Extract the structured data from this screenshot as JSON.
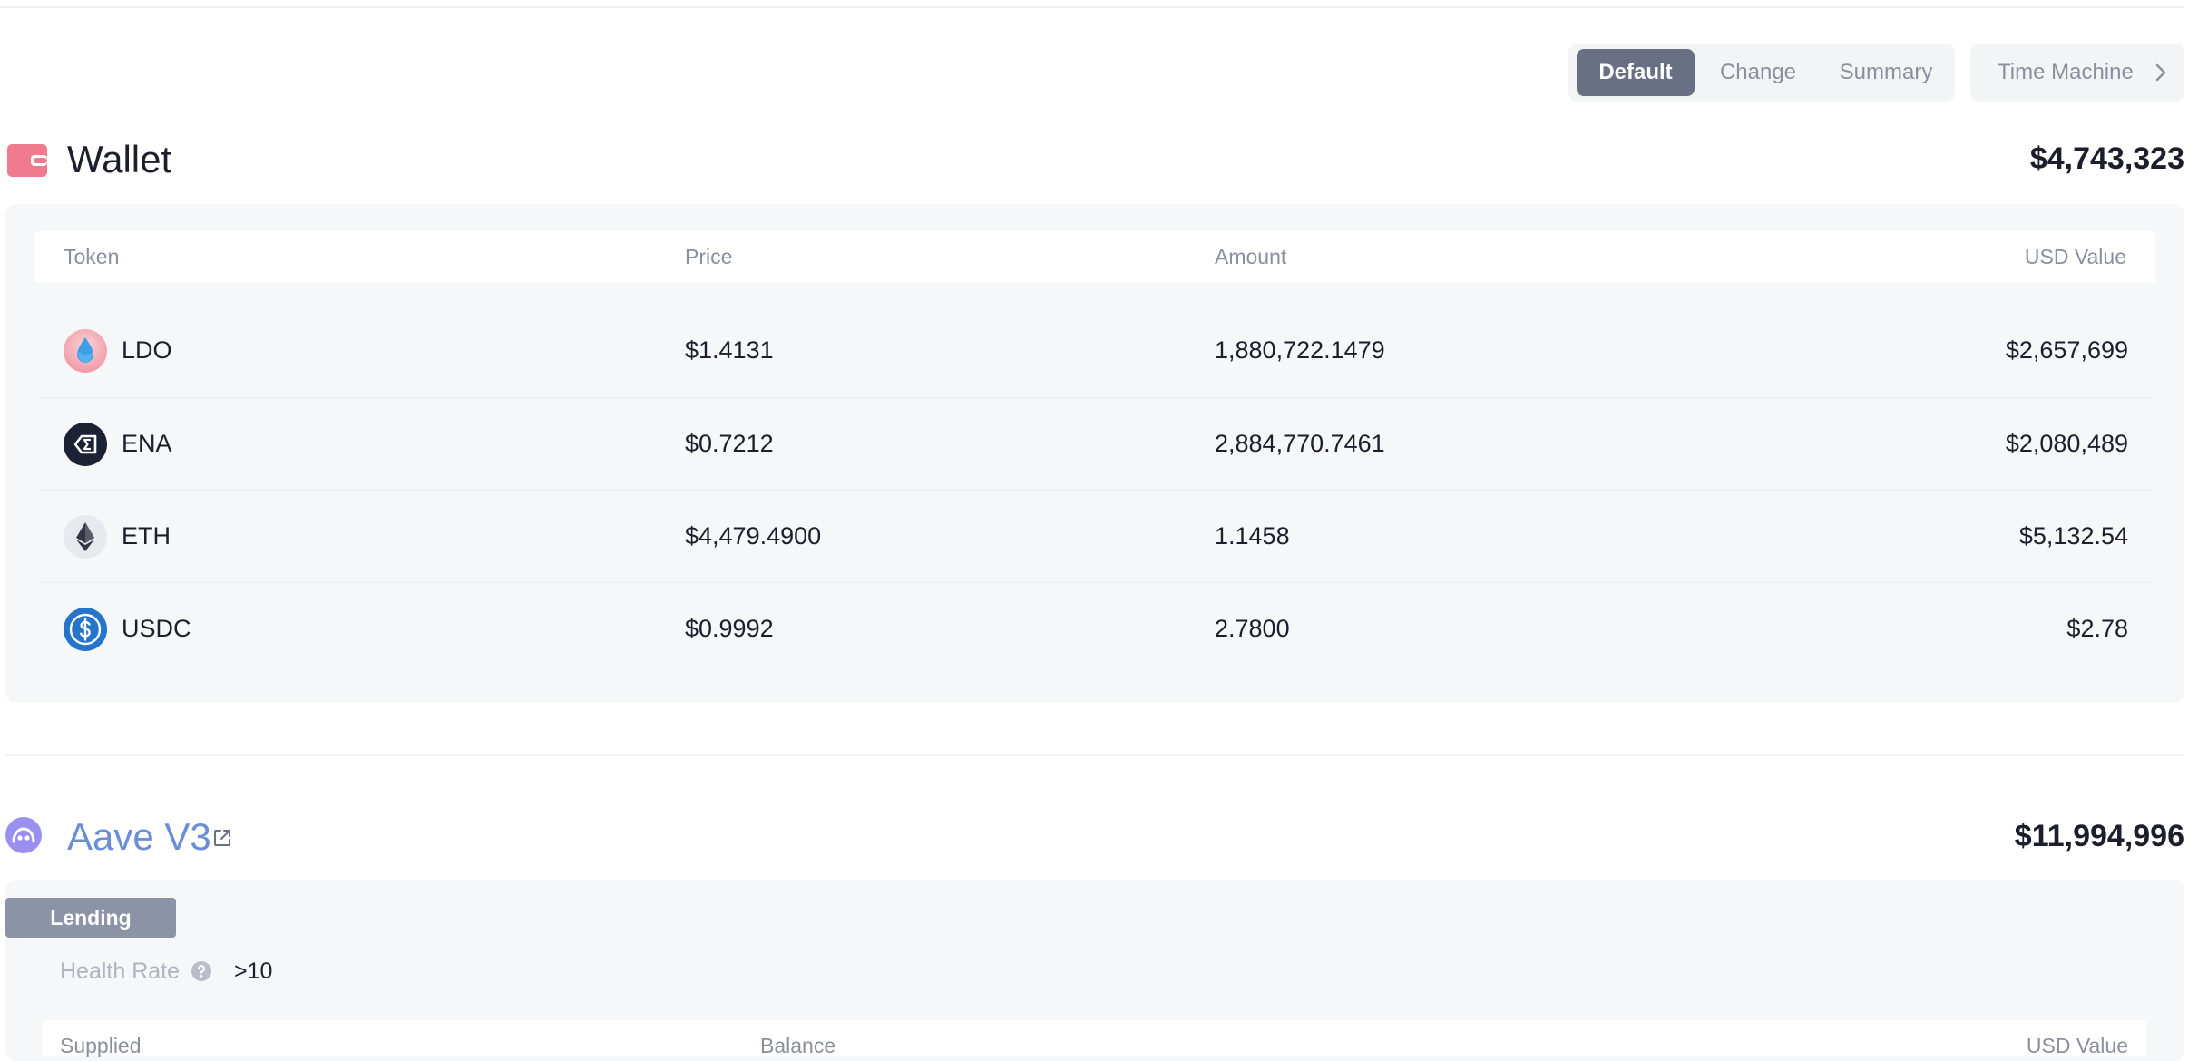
{
  "view_toggle": {
    "options": [
      {
        "label": "Default",
        "active": true
      },
      {
        "label": "Change",
        "active": false
      },
      {
        "label": "Summary",
        "active": false
      }
    ],
    "time_machine_label": "Time Machine"
  },
  "wallet": {
    "title": "Wallet",
    "total": "$4,743,323",
    "columns": {
      "token": "Token",
      "price": "Price",
      "amount": "Amount",
      "usd_value": "USD Value"
    },
    "rows": [
      {
        "token": "LDO",
        "icon": "ldo-token-icon",
        "price": "$1.4131",
        "amount": "1,880,722.1479",
        "usd_value": "$2,657,699"
      },
      {
        "token": "ENA",
        "icon": "ena-token-icon",
        "price": "$0.7212",
        "amount": "2,884,770.7461",
        "usd_value": "$2,080,489"
      },
      {
        "token": "ETH",
        "icon": "eth-token-icon",
        "price": "$4,479.4900",
        "amount": "1.1458",
        "usd_value": "$5,132.54"
      },
      {
        "token": "USDC",
        "icon": "usdc-token-icon",
        "price": "$0.9992",
        "amount": "2.7800",
        "usd_value": "$2.78"
      }
    ]
  },
  "aave": {
    "title": "Aave V3",
    "total": "$11,994,996",
    "tag": "Lending",
    "health_rate_label": "Health Rate",
    "health_rate_value": ">10",
    "columns": {
      "supplied": "Supplied",
      "balance": "Balance",
      "usd_value": "USD Value"
    }
  },
  "colors": {
    "accent_active": "#6a7083",
    "wallet_icon": "#f07b8f",
    "aave_title": "#6b8fd6",
    "aave_icon": "#9b8ff0"
  }
}
